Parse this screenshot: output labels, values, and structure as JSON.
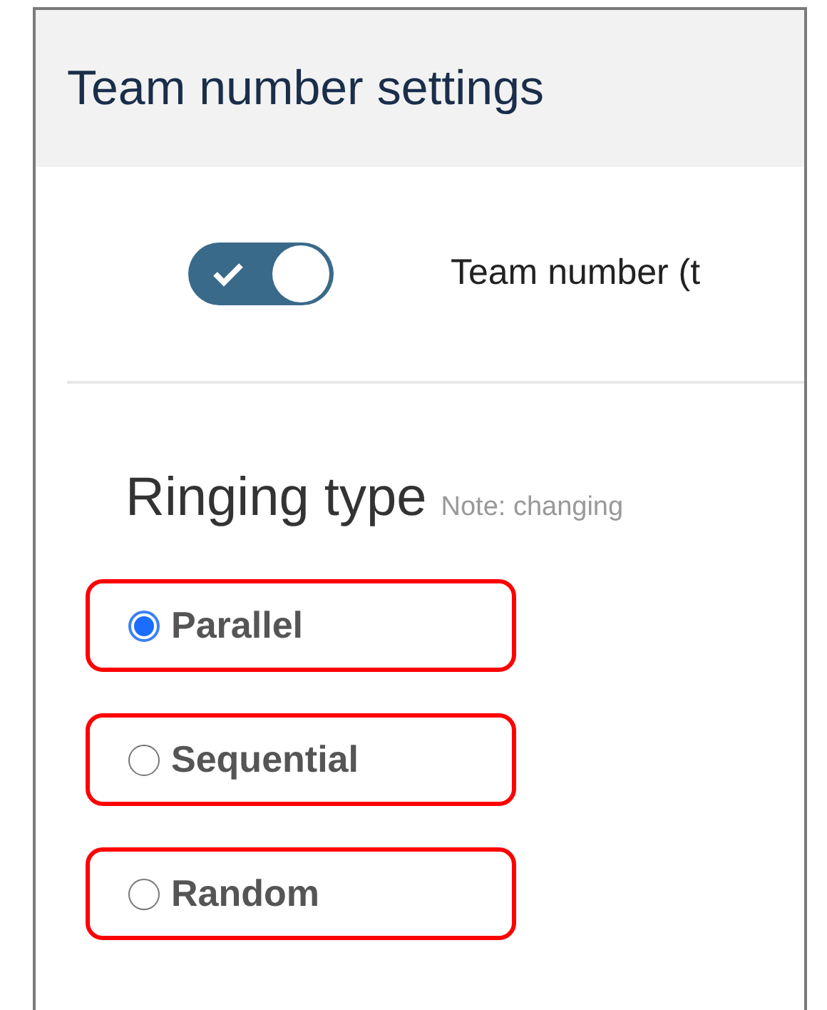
{
  "panel": {
    "title": "Team number settings"
  },
  "toggle": {
    "on": true,
    "label": "Team number (t"
  },
  "ringing_type": {
    "heading": "Ringing type",
    "note": "Note: changing",
    "options": [
      {
        "label": "Parallel",
        "selected": true,
        "highlighted": true
      },
      {
        "label": "Sequential",
        "selected": false,
        "highlighted": true
      },
      {
        "label": "Random",
        "selected": false,
        "highlighted": true
      }
    ]
  }
}
